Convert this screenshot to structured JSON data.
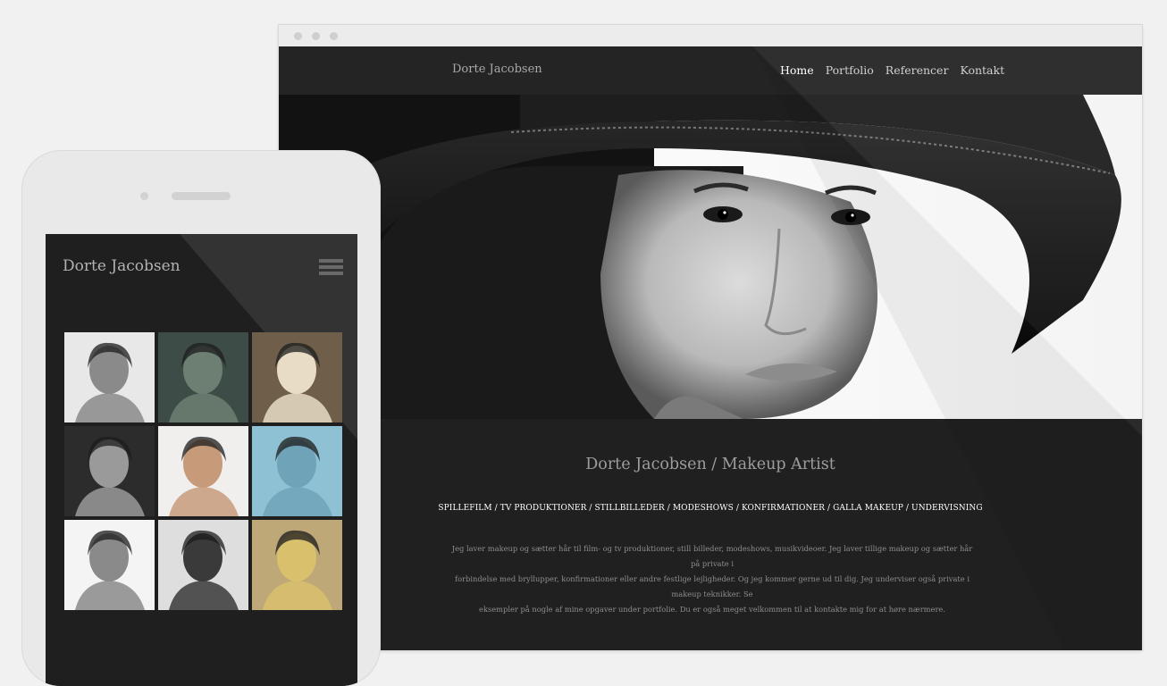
{
  "desktop": {
    "brand": "Dorte Jacobsen",
    "nav": [
      {
        "label": "Home",
        "active": true
      },
      {
        "label": "Portfolio",
        "active": false
      },
      {
        "label": "Referencer",
        "active": false
      },
      {
        "label": "Kontakt",
        "active": false
      }
    ],
    "hero_image": "black-and-white portrait of a woman in a wide-brim hat",
    "title": "Dorte Jacobsen / Makeup Artist",
    "services": "SPILLEFILM / TV PRODUKTIONER / STILLBILLEDER / MODESHOWS / KONFIRMATIONER / GALLA MAKEUP / UNDERVISNING",
    "body_lines": [
      "Jeg laver makeup og sætter hår til film- og tv produktioner, still billeder, modeshows, musikvideoer. Jeg laver tillige makeup og sætter hår på private i",
      "forbindelse med bryllupper, konfirmationer eller andre festlige lejligheder. Og jeg kommer gerne ud til dig. Jeg underviser også private i makeup teknikker. Se",
      "eksempler på nogle af mine opgaver under portfolie. Du er også meget velkommen til at kontakte mig for at høre nærmere."
    ]
  },
  "mobile": {
    "brand": "Dorte Jacobsen",
    "menu_icon": "hamburger-menu-icon",
    "thumbnails": [
      {
        "tone": "#8a8a8a",
        "bg": "#e8e8e8"
      },
      {
        "tone": "#6d7f73",
        "bg": "#3d4c47"
      },
      {
        "tone": "#e8dcc4",
        "bg": "#6f5f4a"
      },
      {
        "tone": "#9a9a9a",
        "bg": "#2c2c2c"
      },
      {
        "tone": "#c79b7a",
        "bg": "#f1efee"
      },
      {
        "tone": "#6fa3b8",
        "bg": "#8fc1d4"
      },
      {
        "tone": "#8a8a8a",
        "bg": "#f4f4f4"
      },
      {
        "tone": "#3a3a3a",
        "bg": "#dedede"
      },
      {
        "tone": "#d9c06c",
        "bg": "#bfa878"
      }
    ]
  }
}
